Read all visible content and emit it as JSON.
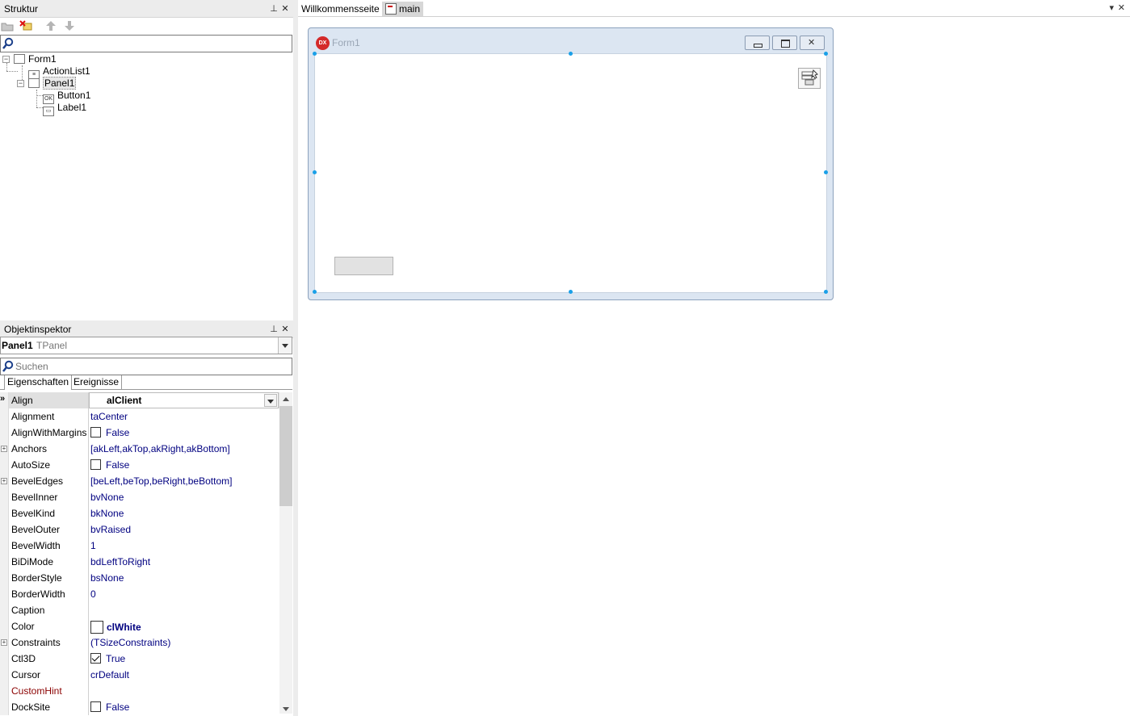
{
  "struktur": {
    "title": "Struktur",
    "search": {
      "value": "",
      "placeholder": ""
    },
    "tree": [
      {
        "label": "Form1",
        "icon": "form-icon"
      },
      {
        "label": "ActionList1",
        "icon": "actionlist-icon"
      },
      {
        "label": "Panel1",
        "icon": "panel-icon"
      },
      {
        "label": "Button1",
        "icon": "button-icon"
      },
      {
        "label": "Label1",
        "icon": "label-icon"
      }
    ]
  },
  "inspector": {
    "title": "Objektinspektor",
    "object_name": "Panel1",
    "object_type": "TPanel",
    "search_placeholder": "Suchen",
    "tabs": [
      "Eigenschaften",
      "Ereignisse"
    ],
    "properties": [
      {
        "name": "Align",
        "value": "alClient"
      },
      {
        "name": "Alignment",
        "value": "taCenter"
      },
      {
        "name": "AlignWithMargins",
        "value": "False"
      },
      {
        "name": "Anchors",
        "value": "[akLeft,akTop,akRight,akBottom]"
      },
      {
        "name": "AutoSize",
        "value": "False"
      },
      {
        "name": "BevelEdges",
        "value": "[beLeft,beTop,beRight,beBottom]"
      },
      {
        "name": "BevelInner",
        "value": "bvNone"
      },
      {
        "name": "BevelKind",
        "value": "bkNone"
      },
      {
        "name": "BevelOuter",
        "value": "bvRaised"
      },
      {
        "name": "BevelWidth",
        "value": "1"
      },
      {
        "name": "BiDiMode",
        "value": "bdLeftToRight"
      },
      {
        "name": "BorderStyle",
        "value": "bsNone"
      },
      {
        "name": "BorderWidth",
        "value": "0"
      },
      {
        "name": "Caption",
        "value": ""
      },
      {
        "name": "Color",
        "value": "clWhite"
      },
      {
        "name": "Constraints",
        "value": "(TSizeConstraints)"
      },
      {
        "name": "Ctl3D",
        "value": "True"
      },
      {
        "name": "Cursor",
        "value": "crDefault"
      },
      {
        "name": "CustomHint",
        "value": ""
      },
      {
        "name": "DockSite",
        "value": "False"
      }
    ]
  },
  "designer": {
    "tabs": [
      {
        "label": "Willkommensseite"
      },
      {
        "label": "main"
      }
    ],
    "form_title": "Form1"
  }
}
